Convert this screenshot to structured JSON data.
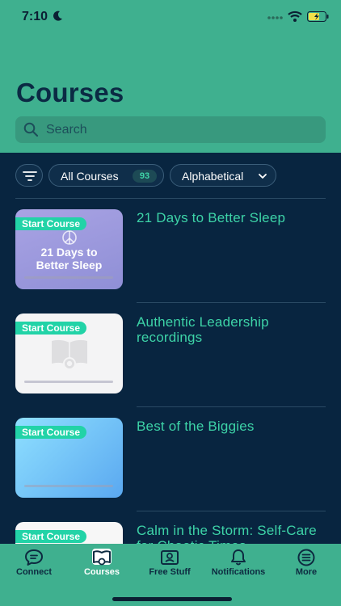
{
  "status": {
    "time": "7:10"
  },
  "header": {
    "title": "Courses"
  },
  "search": {
    "placeholder": "Search"
  },
  "filters": {
    "all_courses_label": "All Courses",
    "all_courses_count": "93",
    "sort_label": "Alphabetical"
  },
  "courses": [
    {
      "title": "21 Days to Better Sleep",
      "badge": "Start Course",
      "thumb_text_top": "21 Days to",
      "thumb_text_bottom": "Better Sleep"
    },
    {
      "title": "Authentic Leadership recordings",
      "badge": "Start Course"
    },
    {
      "title": "Best of the Biggies",
      "badge": "Start Course"
    },
    {
      "title": "Calm in the Storm: Self-Care for Chaotic Times",
      "badge": "Start Course"
    }
  ],
  "tabs": [
    {
      "label": "Connect"
    },
    {
      "label": "Courses"
    },
    {
      "label": "Free Stuff"
    },
    {
      "label": "Notifications"
    },
    {
      "label": "More"
    }
  ],
  "colors": {
    "header_bg": "#3fb08f",
    "content_bg": "#082540",
    "accent": "#3dd3a7",
    "badge_bg": "#22d3a7"
  }
}
